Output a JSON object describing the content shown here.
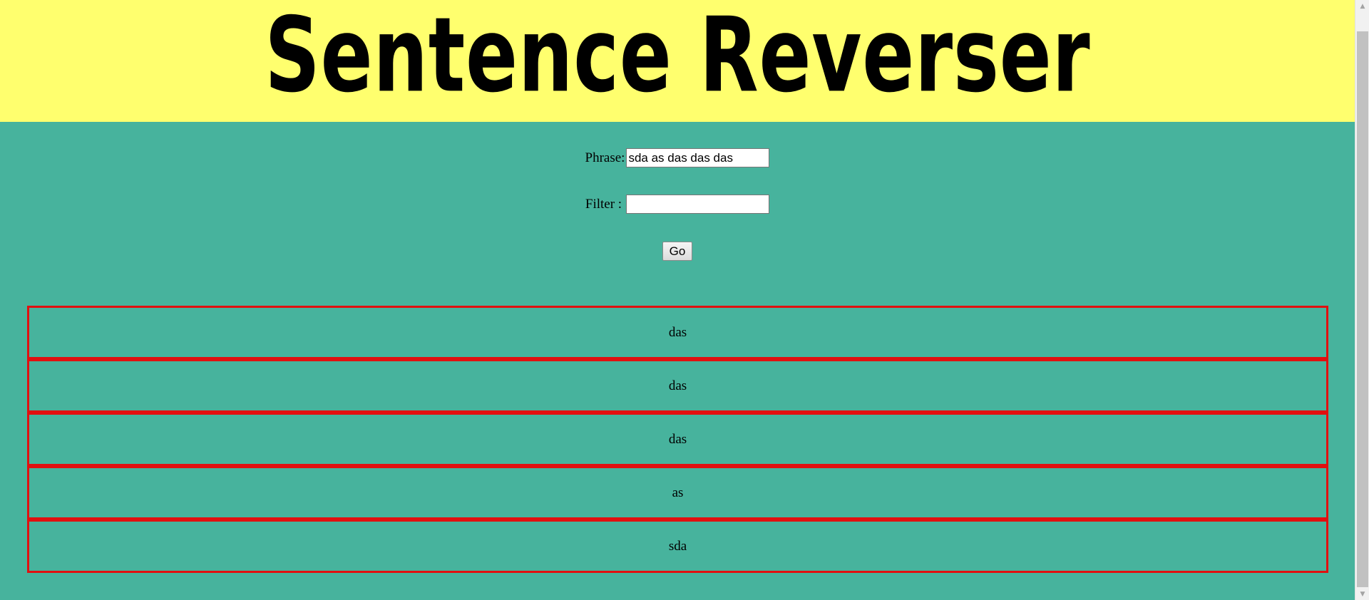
{
  "header": {
    "title": "Sentence Reverser"
  },
  "form": {
    "phrase_label": "Phrase:",
    "phrase_value": "sda as das das das",
    "filter_label": "Filter :",
    "filter_value": "",
    "go_label": "Go"
  },
  "results": {
    "items": [
      "das",
      "das",
      "das",
      "as",
      "sda"
    ]
  },
  "colors": {
    "header_bg": "#ffff6e",
    "page_bg": "#47b39d",
    "result_border": "#e11010"
  },
  "scrollbar": {
    "up_icon": "arrow-up-icon",
    "down_icon": "arrow-down-icon"
  }
}
